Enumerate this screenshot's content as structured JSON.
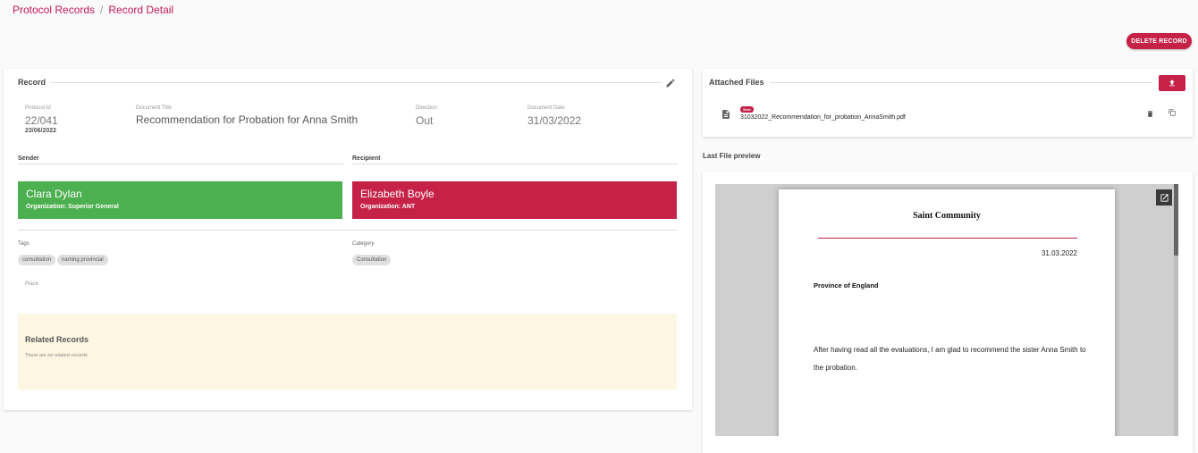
{
  "breadcrumb": {
    "root": "Protocol Records",
    "current": "Record Detail"
  },
  "actions": {
    "delete_label": "DELETE RECORD"
  },
  "record": {
    "section_title": "Record",
    "protocol_id_label": "Protocol Id",
    "protocol_id": "22/041",
    "protocol_date": "23/06/2022",
    "document_title_label": "Document Title",
    "document_title": "Recommendation for Probation for  Anna Smith",
    "direction_label": "Direction",
    "direction": "Out",
    "document_date_label": "Document Date",
    "document_date": "31/03/2022",
    "sender_label": "Sender",
    "recipient_label": "Recipient",
    "sender": {
      "name": "Clara Dylan",
      "org": "Organization: Superior General",
      "color": "#4caf50"
    },
    "recipient": {
      "name": "Elizabeth Boyle",
      "org": "Organization: ANT",
      "color": "#c62146"
    },
    "tags_label": "Tags",
    "tags": [
      "consultation",
      "naming provincial"
    ],
    "category_label": "Category",
    "category": "Consultation",
    "place_label": "Place"
  },
  "related": {
    "title": "Related Records",
    "empty": "There are no related records"
  },
  "files": {
    "section_title": "Attached Files",
    "items": [
      {
        "badge": "Sent",
        "name": "31032022_Recommendation_for_probation_AnnaSmith.pdf"
      }
    ]
  },
  "preview": {
    "label": "Last File preview",
    "org": "Saint Community",
    "date": "31.03.2022",
    "province": "Province of England",
    "body": "After having read all the evaluations, I am glad to recommend the sister Anna Smith to the probation."
  },
  "colors": {
    "accent": "#c62146",
    "success": "#4caf50",
    "related_bg": "#fdf6e3"
  }
}
